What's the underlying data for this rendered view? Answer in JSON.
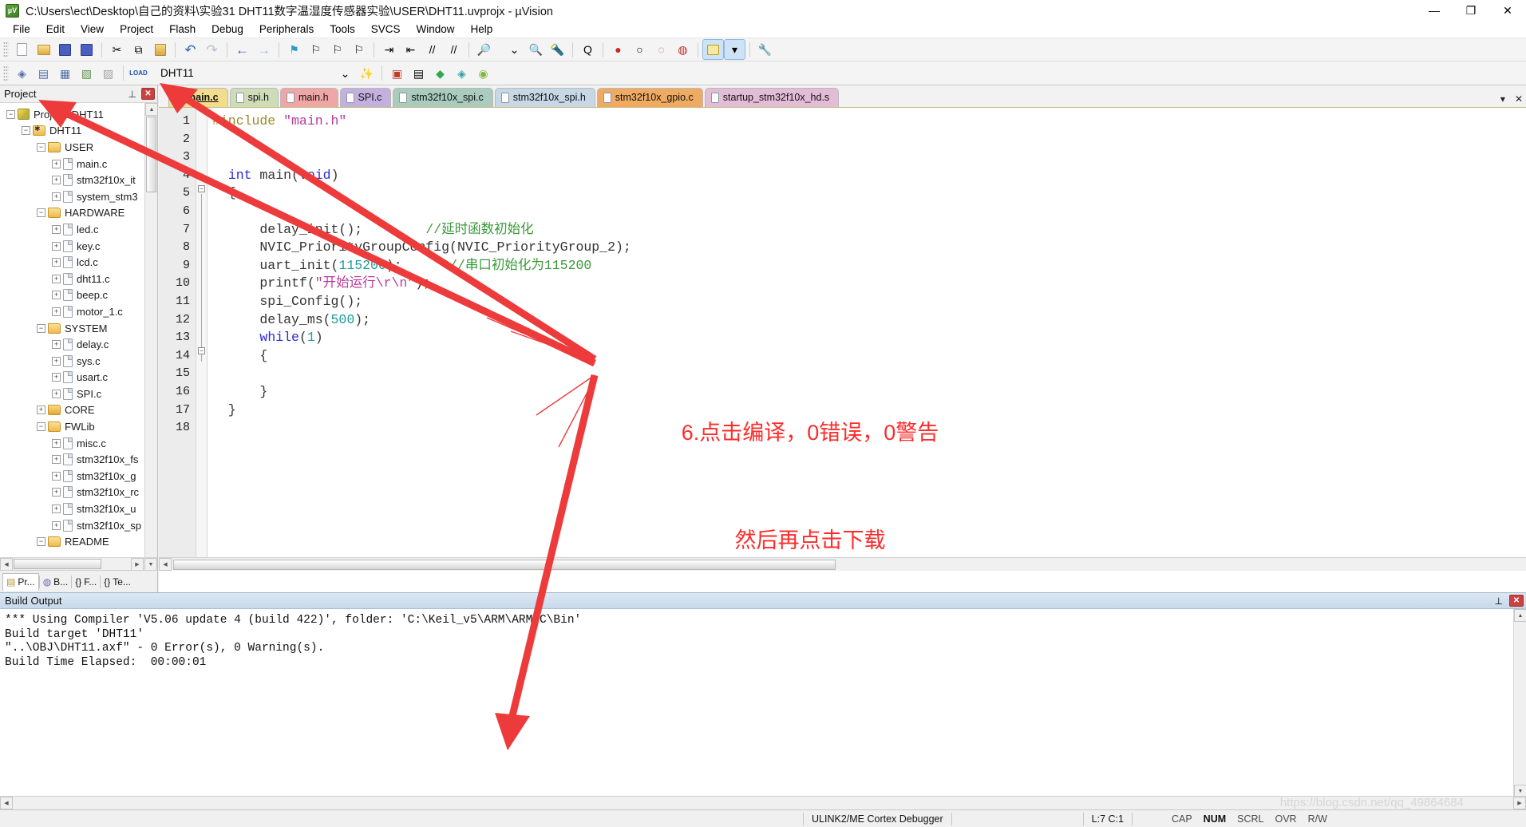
{
  "window": {
    "title": "C:\\Users\\ect\\Desktop\\自己的资料\\实验31 DHT11数字温湿度传感器实验\\USER\\DHT11.uvprojx - µVision",
    "app_icon": "uvision-icon",
    "minimize": "—",
    "restore": "❐",
    "close": "✕"
  },
  "menu": [
    {
      "label": "File"
    },
    {
      "label": "Edit"
    },
    {
      "label": "View"
    },
    {
      "label": "Project"
    },
    {
      "label": "Flash"
    },
    {
      "label": "Debug"
    },
    {
      "label": "Peripherals"
    },
    {
      "label": "Tools"
    },
    {
      "label": "SVCS"
    },
    {
      "label": "Window"
    },
    {
      "label": "Help"
    }
  ],
  "toolbar_main": [
    {
      "name": "new-file-icon",
      "glyph": "🗋"
    },
    {
      "name": "open-file-icon",
      "glyph": "📂"
    },
    {
      "name": "save-icon",
      "glyph": "💾"
    },
    {
      "name": "save-all-icon",
      "glyph": "🖫"
    },
    {
      "sep": true
    },
    {
      "name": "cut-icon",
      "glyph": "✂"
    },
    {
      "name": "copy-icon",
      "glyph": "⧉"
    },
    {
      "name": "paste-icon",
      "glyph": "📋"
    },
    {
      "sep": true
    },
    {
      "name": "undo-icon",
      "glyph": "↶"
    },
    {
      "name": "redo-icon",
      "glyph": "↷"
    },
    {
      "sep": true
    },
    {
      "name": "navigate-backward-icon",
      "glyph": "←"
    },
    {
      "name": "navigate-forward-icon",
      "glyph": "→"
    },
    {
      "sep": true
    },
    {
      "name": "toggle-bookmark-icon",
      "glyph": "⚑"
    },
    {
      "name": "previous-bookmark-icon",
      "glyph": "⚐"
    },
    {
      "name": "next-bookmark-icon",
      "glyph": "⚐"
    },
    {
      "name": "clear-bookmarks-icon",
      "glyph": "⚐"
    },
    {
      "sep": true
    },
    {
      "name": "indent-icon",
      "glyph": "⇥"
    },
    {
      "name": "outdent-icon",
      "glyph": "⇤"
    },
    {
      "name": "comment-icon",
      "glyph": "//"
    },
    {
      "name": "uncomment-icon",
      "glyph": "//"
    },
    {
      "sep": true
    },
    {
      "name": "find-in-files-icon",
      "glyph": "🔎"
    }
  ],
  "toolbar_main_right": [
    {
      "name": "search-combo-arrow-icon",
      "glyph": "⌄"
    },
    {
      "name": "find-icon",
      "glyph": "🔍"
    },
    {
      "name": "incremental-find-icon",
      "glyph": "🔦"
    },
    {
      "sep": true
    },
    {
      "name": "debug-session-icon",
      "glyph": "Q"
    },
    {
      "sep": true
    },
    {
      "name": "insert-breakpoint-icon",
      "glyph": "●"
    },
    {
      "name": "kill-breakpoint-icon",
      "glyph": "○"
    },
    {
      "name": "disable-breakpoint-icon",
      "glyph": "◌"
    },
    {
      "name": "kill-all-breakpoints-icon",
      "glyph": "◍"
    },
    {
      "sep": true
    },
    {
      "name": "manage-windows-icon",
      "glyph": "▤"
    },
    {
      "name": "manage-windows-dropdown-icon",
      "glyph": "▾"
    },
    {
      "sep": true
    },
    {
      "name": "configure-icon",
      "glyph": "🔧"
    }
  ],
  "toolbar_build": [
    {
      "name": "translate-icon",
      "glyph": "◈"
    },
    {
      "name": "build-icon",
      "glyph": "▤"
    },
    {
      "name": "rebuild-icon",
      "glyph": "▦"
    },
    {
      "name": "batch-build-icon",
      "glyph": "▧"
    },
    {
      "name": "stop-build-icon",
      "glyph": "▨"
    },
    {
      "sep": true
    },
    {
      "name": "download-icon",
      "glyph": "LOAD"
    }
  ],
  "toolbar_build_right": [
    {
      "name": "target-dropdown-icon",
      "glyph": "⌄"
    },
    {
      "name": "target-options-icon",
      "glyph": "✨"
    },
    {
      "sep": true
    },
    {
      "name": "manage-project-items-icon",
      "glyph": "▣"
    },
    {
      "name": "manage-multi-project-icon",
      "glyph": "▤"
    },
    {
      "name": "manage-run-time-env-icon",
      "glyph": "◆"
    },
    {
      "name": "select-software-packs-icon",
      "glyph": "◈"
    },
    {
      "name": "pack-installer-icon",
      "glyph": "◉"
    }
  ],
  "target": {
    "label": "DHT11",
    "dropdown_glyph": "⌄"
  },
  "project_panel": {
    "title": "Project",
    "pin_glyph": "📌",
    "close_glyph": "✖",
    "tree": [
      {
        "indent": 0,
        "expander": "−",
        "icon": "project-icon",
        "label": "Project: DHT11"
      },
      {
        "indent": 1,
        "expander": "−",
        "icon": "target-icon",
        "label": "DHT11"
      },
      {
        "indent": 2,
        "expander": "−",
        "icon": "folder-open",
        "label": "USER"
      },
      {
        "indent": 3,
        "expander": "+",
        "icon": "file",
        "label": "main.c"
      },
      {
        "indent": 3,
        "expander": "+",
        "icon": "file",
        "label": "stm32f10x_it"
      },
      {
        "indent": 3,
        "expander": "+",
        "icon": "file",
        "label": "system_stm3"
      },
      {
        "indent": 2,
        "expander": "−",
        "icon": "folder-open",
        "label": "HARDWARE"
      },
      {
        "indent": 3,
        "expander": "+",
        "icon": "file",
        "label": "led.c"
      },
      {
        "indent": 3,
        "expander": "+",
        "icon": "file",
        "label": "key.c"
      },
      {
        "indent": 3,
        "expander": "+",
        "icon": "file",
        "label": "lcd.c"
      },
      {
        "indent": 3,
        "expander": "+",
        "icon": "file",
        "label": "dht11.c"
      },
      {
        "indent": 3,
        "expander": "+",
        "icon": "file",
        "label": "beep.c"
      },
      {
        "indent": 3,
        "expander": "+",
        "icon": "file",
        "label": "motor_1.c"
      },
      {
        "indent": 2,
        "expander": "−",
        "icon": "folder-open",
        "label": "SYSTEM"
      },
      {
        "indent": 3,
        "expander": "+",
        "icon": "file",
        "label": "delay.c"
      },
      {
        "indent": 3,
        "expander": "+",
        "icon": "file",
        "label": "sys.c"
      },
      {
        "indent": 3,
        "expander": "+",
        "icon": "file",
        "label": "usart.c"
      },
      {
        "indent": 3,
        "expander": "+",
        "icon": "file",
        "label": "SPI.c"
      },
      {
        "indent": 2,
        "expander": "+",
        "icon": "folder-closed",
        "label": "CORE"
      },
      {
        "indent": 2,
        "expander": "−",
        "icon": "folder-open",
        "label": "FWLib"
      },
      {
        "indent": 3,
        "expander": "+",
        "icon": "file",
        "label": "misc.c"
      },
      {
        "indent": 3,
        "expander": "+",
        "icon": "file",
        "label": "stm32f10x_fs"
      },
      {
        "indent": 3,
        "expander": "+",
        "icon": "file",
        "label": "stm32f10x_g"
      },
      {
        "indent": 3,
        "expander": "+",
        "icon": "file",
        "label": "stm32f10x_rc"
      },
      {
        "indent": 3,
        "expander": "+",
        "icon": "file",
        "label": "stm32f10x_u"
      },
      {
        "indent": 3,
        "expander": "+",
        "icon": "file",
        "label": "stm32f10x_sp"
      },
      {
        "indent": 2,
        "expander": "−",
        "icon": "folder-open",
        "label": "README"
      }
    ],
    "tabs": [
      {
        "label": "Pr...",
        "icon": "project-tab-icon",
        "glyph": "▤",
        "active": true
      },
      {
        "label": "B...",
        "icon": "books-tab-icon",
        "glyph": "◍",
        "active": false
      },
      {
        "label": "F...",
        "icon": "functions-tab-icon",
        "glyph": "{}",
        "active": false
      },
      {
        "label": "Te...",
        "icon": "templates-tab-icon",
        "glyph": "{}",
        "active": false
      }
    ]
  },
  "editor": {
    "tabs": [
      {
        "label": "main.c",
        "color": "#f2dd8c",
        "active": true
      },
      {
        "label": "spi.h",
        "color": "#cfdcb8",
        "active": false
      },
      {
        "label": "main.h",
        "color": "#efa6a6",
        "active": false
      },
      {
        "label": "SPI.c",
        "color": "#c3b0de",
        "active": false
      },
      {
        "label": "stm32f10x_spi.c",
        "color": "#a9ccbe",
        "active": false
      },
      {
        "label": "stm32f10x_spi.h",
        "color": "#c6d7e6",
        "active": false
      },
      {
        "label": "stm32f10x_gpio.c",
        "color": "#f0ab63",
        "active": false
      },
      {
        "label": "startup_stm32f10x_hd.s",
        "color": "#e3bcd8",
        "active": false
      }
    ],
    "tabbar_dropdown_glyph": "▾",
    "tabbar_close_glyph": "✕",
    "line_numbers": [
      "1",
      "2",
      "3",
      "4",
      "5",
      "6",
      "7",
      "8",
      "9",
      "10",
      "11",
      "12",
      "13",
      "14",
      "15",
      "16",
      "17",
      "18"
    ],
    "code_lines": [
      [
        {
          "t": "#include ",
          "c": "k-pre"
        },
        {
          "t": "\"main.h\"",
          "c": "k-str"
        }
      ],
      [],
      [],
      [
        {
          "t": "  ",
          "c": "k-txt"
        },
        {
          "t": "int",
          "c": "k-key"
        },
        {
          "t": " main(",
          "c": "k-txt"
        },
        {
          "t": "void",
          "c": "k-key"
        },
        {
          "t": ")",
          "c": "k-txt"
        }
      ],
      [
        {
          "t": "  {",
          "c": "k-txt"
        }
      ],
      [],
      [
        {
          "t": "      delay_init();        ",
          "c": "k-txt"
        },
        {
          "t": "//延时函数初始化",
          "c": "k-cmt"
        }
      ],
      [
        {
          "t": "      NVIC_PriorityGroupConfig(NVIC_PriorityGroup_2);",
          "c": "k-txt"
        }
      ],
      [
        {
          "t": "      uart_init(",
          "c": "k-txt"
        },
        {
          "t": "115200",
          "c": "k-num"
        },
        {
          "t": ");      ",
          "c": "k-txt"
        },
        {
          "t": "//串口初始化为115200",
          "c": "k-cmt"
        }
      ],
      [
        {
          "t": "      printf(",
          "c": "k-txt"
        },
        {
          "t": "\"开始运行\\r\\n\"",
          "c": "k-str"
        },
        {
          "t": ");",
          "c": "k-txt"
        }
      ],
      [
        {
          "t": "      spi_Config();",
          "c": "k-txt"
        }
      ],
      [
        {
          "t": "      delay_ms(",
          "c": "k-txt"
        },
        {
          "t": "500",
          "c": "k-num"
        },
        {
          "t": ");",
          "c": "k-txt"
        }
      ],
      [
        {
          "t": "      ",
          "c": "k-txt"
        },
        {
          "t": "while",
          "c": "k-key"
        },
        {
          "t": "(",
          "c": "k-txt"
        },
        {
          "t": "1",
          "c": "k-num"
        },
        {
          "t": ")",
          "c": "k-txt"
        }
      ],
      [
        {
          "t": "      {",
          "c": "k-txt"
        }
      ],
      [],
      [
        {
          "t": "      }",
          "c": "k-txt"
        }
      ],
      [
        {
          "t": "  }",
          "c": "k-txt"
        }
      ],
      []
    ]
  },
  "build_output": {
    "title": "Build Output",
    "pin_glyph": "📌",
    "close_glyph": "✖",
    "lines": [
      "*** Using Compiler 'V5.06 update 4 (build 422)', folder: 'C:\\Keil_v5\\ARM\\ARMCC\\Bin'",
      "Build target 'DHT11'",
      "\"..\\OBJ\\DHT11.axf\" - 0 Error(s), 0 Warning(s).",
      "Build Time Elapsed:  00:00:01"
    ]
  },
  "statusbar": {
    "debugger": "ULINK2/ME Cortex Debugger",
    "position": "L:7 C:1",
    "indicators": [
      {
        "label": "CAP",
        "on": false
      },
      {
        "label": "NUM",
        "on": true
      },
      {
        "label": "SCRL",
        "on": false
      },
      {
        "label": "OVR",
        "on": false
      },
      {
        "label": "R/W",
        "on": false
      }
    ]
  },
  "annotations": {
    "line1": "6.点击编译，0错误，0警告",
    "line2": "然后再点击下载",
    "color": "#ff2b2b"
  },
  "watermark": "https://blog.csdn.net/qq_49864684"
}
